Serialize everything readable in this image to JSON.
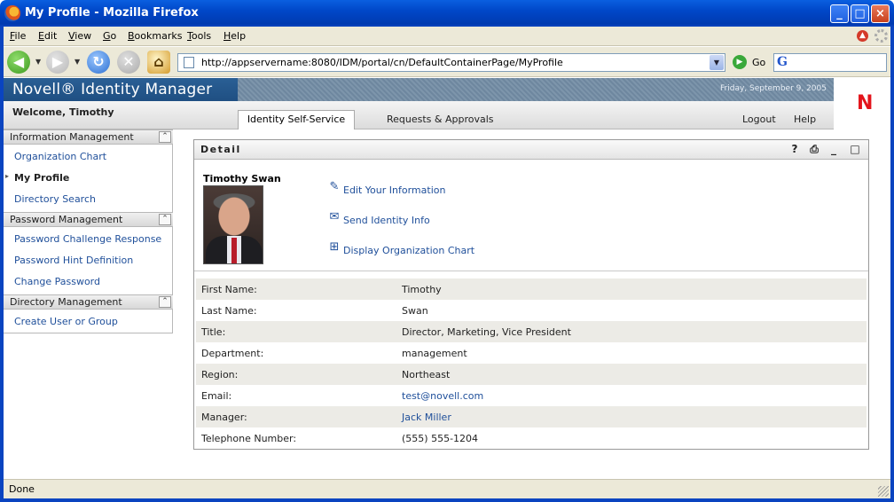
{
  "window": {
    "title": "My Profile - Mozilla Firefox"
  },
  "menu": {
    "items": [
      "File",
      "Edit",
      "View",
      "Go",
      "Bookmarks",
      "Tools",
      "Help"
    ]
  },
  "toolbar": {
    "url": "http://appservername:8080/IDM/portal/cn/DefaultContainerPage/MyProfile",
    "go_label": "Go",
    "search_value": ""
  },
  "header": {
    "brand": "Novell® Identity Manager",
    "date": "Friday, September 9, 2005",
    "logo_letter": "N",
    "welcome": "Welcome, Timothy",
    "tabs": [
      "Identity Self-Service",
      "Requests & Approvals"
    ],
    "active_tab": "Identity Self-Service",
    "logout": "Logout",
    "help": "Help"
  },
  "sidebar": {
    "sections": [
      {
        "title": "Information Management",
        "items": [
          "Organization Chart",
          "My Profile",
          "Directory Search"
        ]
      },
      {
        "title": "Password Management",
        "items": [
          "Password Challenge Response",
          "Password Hint Definition",
          "Change Password"
        ]
      },
      {
        "title": "Directory Management",
        "items": [
          "Create User or Group"
        ]
      }
    ],
    "current_item": "My Profile"
  },
  "detail": {
    "title": "Detail",
    "person_name": "Timothy Swan",
    "actions": [
      "Edit Your Information",
      "Send Identity Info",
      "Display Organization Chart"
    ],
    "fields": [
      {
        "label": "First Name:",
        "value": "Timothy"
      },
      {
        "label": "Last Name:",
        "value": "Swan"
      },
      {
        "label": "Title:",
        "value": "Director, Marketing, Vice President"
      },
      {
        "label": "Department:",
        "value": "management"
      },
      {
        "label": "Region:",
        "value": "Northeast"
      },
      {
        "label": "Email:",
        "value": "test@novell.com"
      },
      {
        "label": "Manager:",
        "value": "Jack Miller"
      },
      {
        "label": "Telephone Number:",
        "value": "(555) 555-1204"
      }
    ]
  },
  "status": {
    "text": "Done"
  },
  "colors": {
    "titlebar": "#0047c8",
    "link": "#1f4f9a",
    "novell_red": "#e3141b",
    "banner": "#2a5f95"
  }
}
